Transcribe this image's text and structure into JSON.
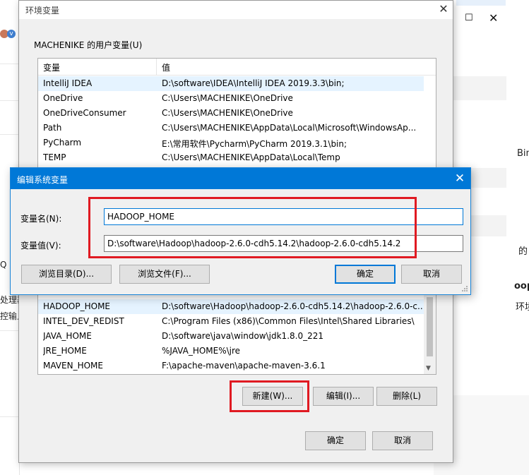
{
  "background": {
    "left_fragments": [
      "Q",
      "处理器",
      "控输入"
    ],
    "right_fragments": [
      "Bin",
      "的",
      "oop",
      "环境"
    ],
    "window_controls": {
      "maximize_icon": "maximize-icon",
      "close_icon": "close-icon",
      "maximize_glyph": "☐",
      "close_glyph": "✕"
    },
    "avatar_glyph": "v"
  },
  "env_dialog": {
    "title": "环境变量",
    "close_glyph": "✕",
    "user_section_label": "MACHENIKE 的用户变量(U)",
    "columns": [
      "变量",
      "值"
    ],
    "user_variables": [
      {
        "name": "IntelliJ IDEA",
        "value": "D:\\software\\IDEA\\IntelliJ IDEA 2019.3.3\\bin;"
      },
      {
        "name": "OneDrive",
        "value": "C:\\Users\\MACHENIKE\\OneDrive"
      },
      {
        "name": "OneDriveConsumer",
        "value": "C:\\Users\\MACHENIKE\\OneDrive"
      },
      {
        "name": "Path",
        "value": "C:\\Users\\MACHENIKE\\AppData\\Local\\Microsoft\\WindowsAp..."
      },
      {
        "name": "PyCharm",
        "value": "E:\\常用软件\\Pycharm\\PyCharm 2019.3.1\\bin;"
      },
      {
        "name": "TEMP",
        "value": "C:\\Users\\MACHENIKE\\AppData\\Local\\Temp"
      }
    ],
    "system_variables": [
      {
        "name": "HADOOP_HOME",
        "value": "D:\\software\\Hadoop\\hadoop-2.6.0-cdh5.14.2\\hadoop-2.6.0-c..."
      },
      {
        "name": "INTEL_DEV_REDIST",
        "value": "C:\\Program Files (x86)\\Common Files\\Intel\\Shared Libraries\\"
      },
      {
        "name": "JAVA_HOME",
        "value": "D:\\software\\java\\window\\jdk1.8.0_221"
      },
      {
        "name": "JRE_HOME",
        "value": "%JAVA_HOME%\\jre"
      },
      {
        "name": "MAVEN_HOME",
        "value": "F:\\apache-maven\\apache-maven-3.6.1"
      }
    ],
    "system_buttons": {
      "new": "新建(W)...",
      "edit": "编辑(I)...",
      "delete": "删除(L)"
    },
    "footer_buttons": {
      "ok": "确定",
      "cancel": "取消"
    },
    "highlight_color": "#e01a22"
  },
  "edit_dialog": {
    "title": "编辑系统变量",
    "close_glyph": "✕",
    "name_label": "变量名(N):",
    "name_value": "HADOOP_HOME",
    "value_label": "变量值(V):",
    "value_value": "D:\\software\\Hadoop\\hadoop-2.6.0-cdh5.14.2\\hadoop-2.6.0-cdh5.14.2",
    "buttons": {
      "browse_dir": "浏览目录(D)...",
      "browse_file": "浏览文件(F)...",
      "ok": "确定",
      "cancel": "取消"
    },
    "accent_color": "#0078d7"
  }
}
